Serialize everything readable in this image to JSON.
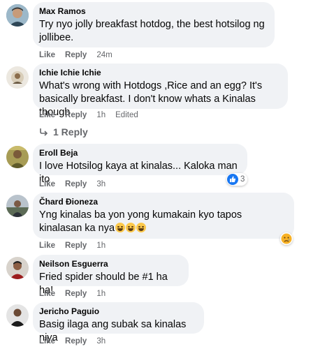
{
  "comments": [
    {
      "author": "Max Ramos",
      "text": "Try nyo jolly breakfast hotdog, the best hotsilog ng jollibee.",
      "like": "Like",
      "reply": "Reply",
      "time": "24m"
    },
    {
      "author": "Ichie Ichie Ichie",
      "text": "What's wrong with Hotdogs ,Rice and an egg? It's basically breakfast. I don't know whats a Kinalas though",
      "like": "Like",
      "reply": "Reply",
      "time": "1h",
      "edited": "Edited",
      "replies_label": "1 Reply"
    },
    {
      "author": "Eroll Beja",
      "text": "I love Hotsilog kaya at kinalas... Kaloka man ito",
      "like": "Like",
      "reply": "Reply",
      "time": "3h",
      "reaction_count": "3"
    },
    {
      "author": "Čhard Đioneza",
      "text": "Yng kinalas ba yon yong kumakain kyo tapos kinalasan ka nya",
      "like": "Like",
      "reply": "Reply",
      "time": "1h"
    },
    {
      "author": "Neilson Esguerra",
      "text": "Fried spider should be #1 ha ha!",
      "like": "Like",
      "reply": "Reply",
      "time": "1h"
    },
    {
      "author": "Jericho Paguio",
      "text": "Basig ilaga ang subak sa kinalas niya",
      "like": "Like",
      "reply": "Reply",
      "time": "3h"
    }
  ],
  "colors": {
    "bubble": "#f0f2f5",
    "meta": "#65676b",
    "like_blue": "#1877f2",
    "haha_yellow": "#fbc84b"
  }
}
